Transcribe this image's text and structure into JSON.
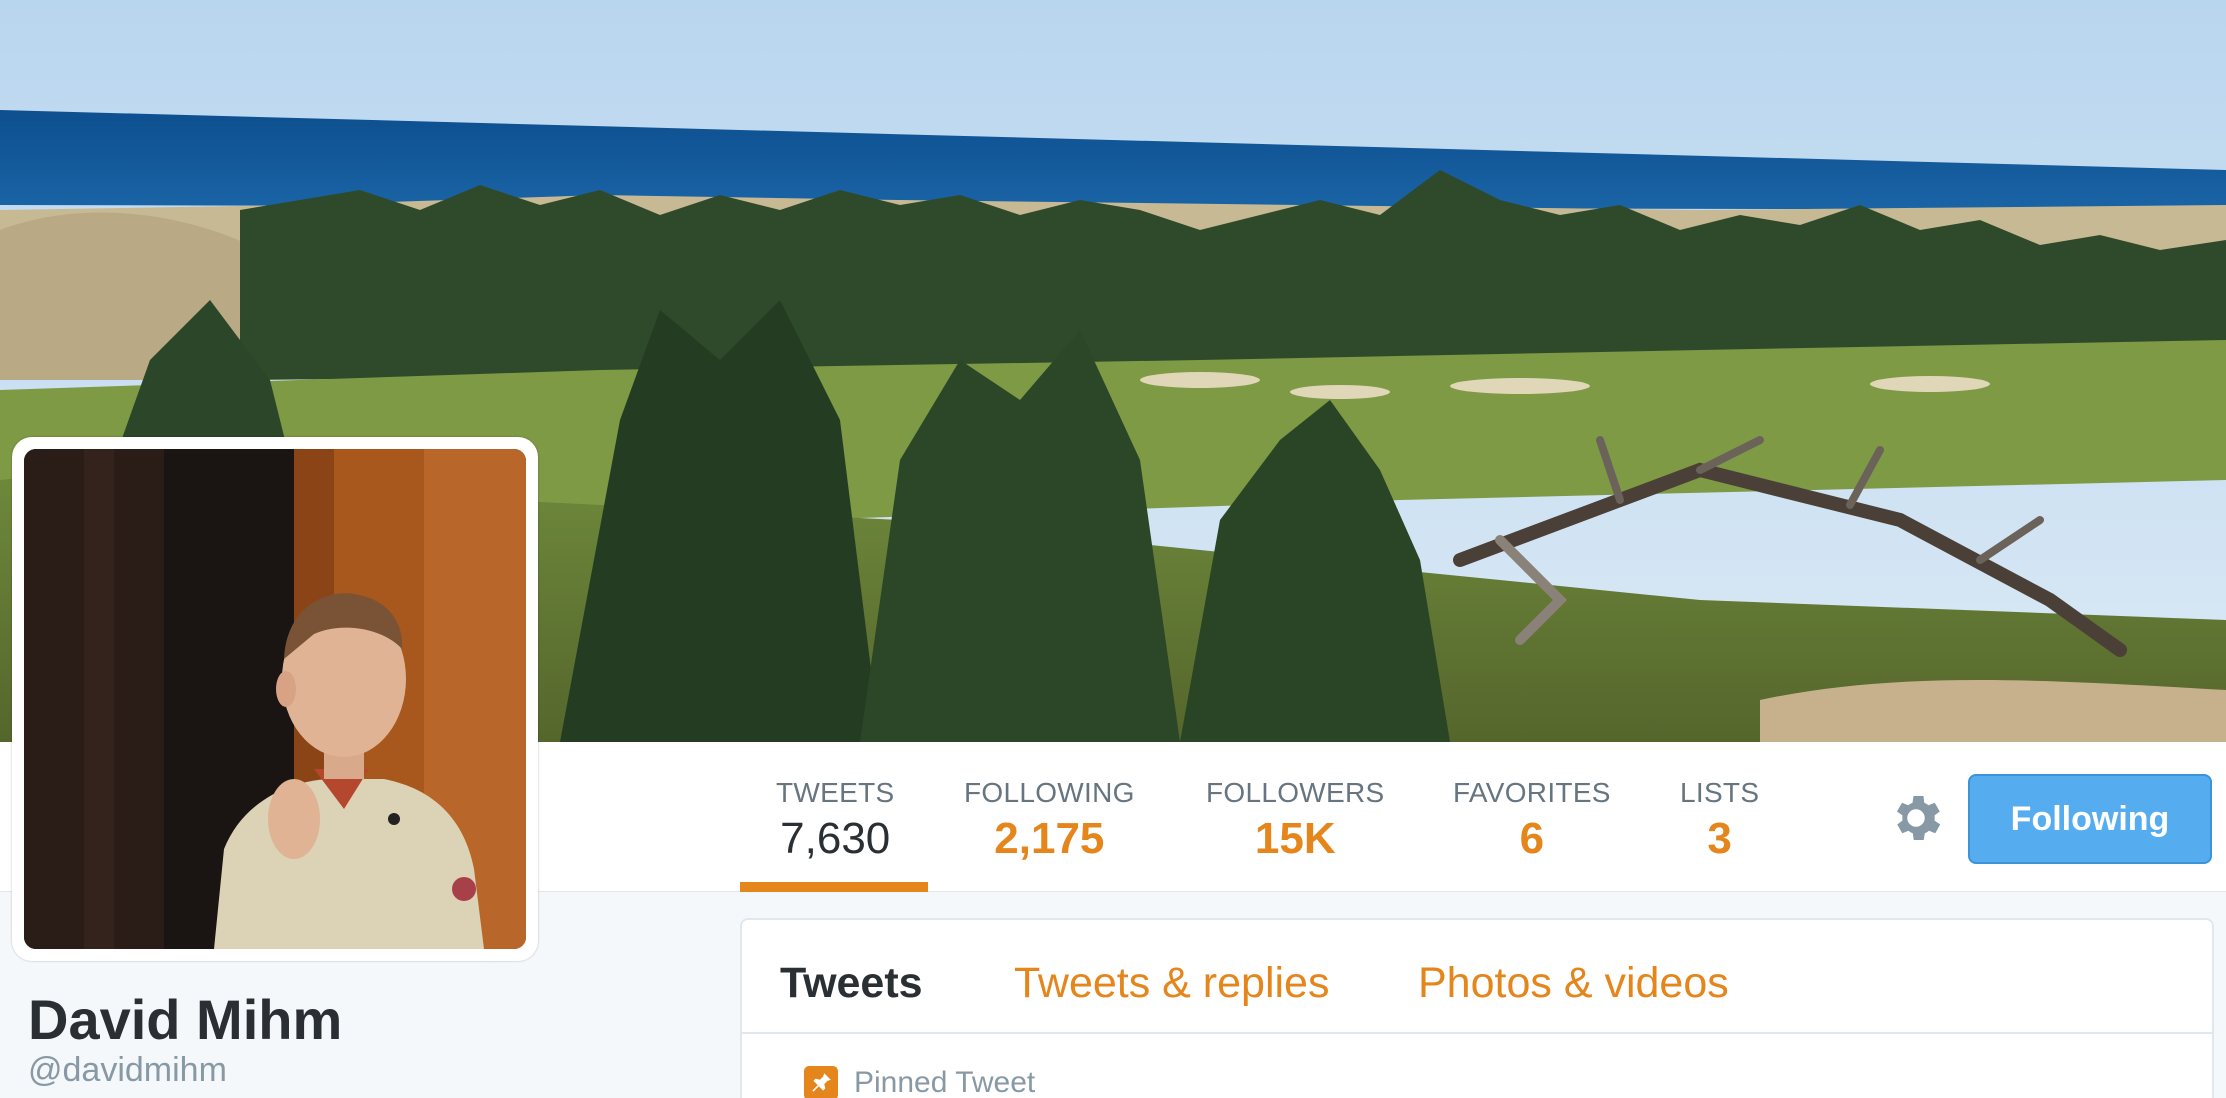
{
  "profile": {
    "name": "David Mihm",
    "handle": "@davidmihm"
  },
  "stats": [
    {
      "label": "TWEETS",
      "value": "7,630",
      "active": true
    },
    {
      "label": "FOLLOWING",
      "value": "2,175",
      "active": false
    },
    {
      "label": "FOLLOWERS",
      "value": "15K",
      "active": false
    },
    {
      "label": "FAVORITES",
      "value": "6",
      "active": false
    },
    {
      "label": "LISTS",
      "value": "3",
      "active": false
    }
  ],
  "actions": {
    "follow_label": "Following",
    "settings_icon": "gear-icon"
  },
  "timeline": {
    "tabs": [
      {
        "label": "Tweets",
        "active": true
      },
      {
        "label": "Tweets & replies",
        "active": false
      },
      {
        "label": "Photos & videos",
        "active": false
      }
    ],
    "pinned_label": "Pinned Tweet",
    "pinned_icon": "pin-icon"
  },
  "colors": {
    "accent": "#e5861d",
    "button": "#55acee",
    "text_dark": "#292f33",
    "text_muted": "#8899a6"
  }
}
